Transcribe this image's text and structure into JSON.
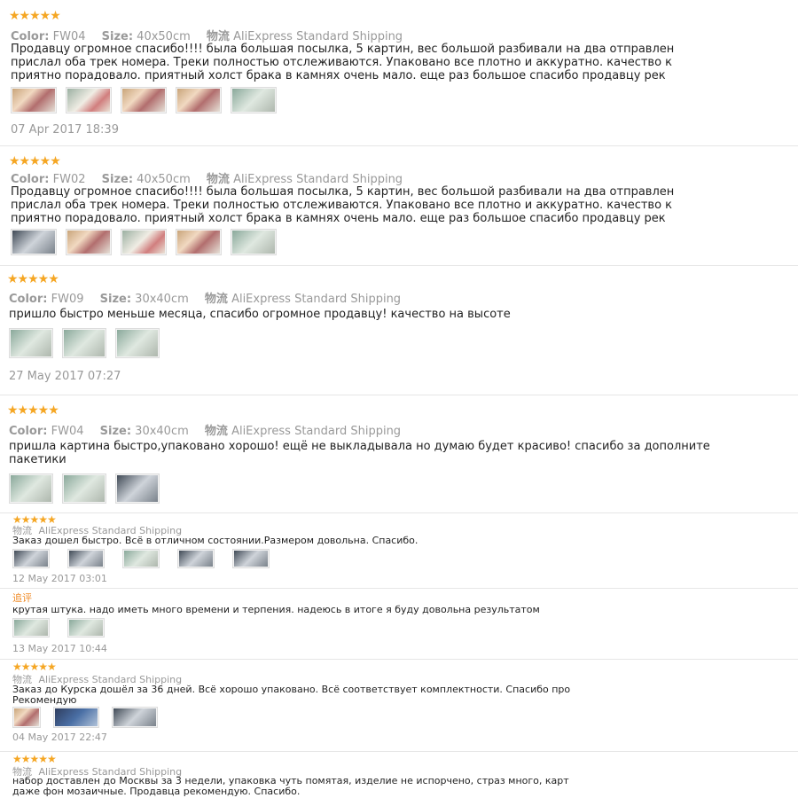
{
  "reviews": [
    {
      "color_label": "Color:",
      "color": "FW04",
      "size_label": "Size:",
      "size": "40x50cm",
      "ship_label": "物流",
      "shipping": "AliExpress Standard Shipping",
      "text": "Продавцу огромное спасибо!!!! была большая посылка, 5 картин, вес большой разбивали на два отправлен\nприслал оба трек номера. Треки полностью отслеживаются. Упаковано все плотно и аккуратно. качество к\nприятно порадовало. приятный холст брака в камнях очень мало. еще раз большое спасибо продавцу рек",
      "date": "07 Apr 2017 18:39"
    },
    {
      "color_label": "Color:",
      "color": "FW02",
      "size_label": "Size:",
      "size": "40x50cm",
      "ship_label": "物流",
      "shipping": "AliExpress Standard Shipping",
      "text": "Продавцу огромное спасибо!!!! была большая посылка, 5 картин, вес большой разбивали на два отправлен\nприслал оба трек номера. Треки полностью отслеживаются. Упаковано все плотно и аккуратно. качество к\nприятно порадовало. приятный холст брака в камнях очень мало. еще раз большое спасибо продавцу рек"
    },
    {
      "color_label": "Color:",
      "color": "FW09",
      "size_label": "Size:",
      "size": "30x40cm",
      "ship_label": "物流",
      "shipping": "AliExpress Standard Shipping",
      "text": "пришло быстро меньше месяца, спасибо огромное продавцу! качество на высоте",
      "date": "27 May 2017 07:27"
    },
    {
      "color_label": "Color:",
      "color": "FW04",
      "size_label": "Size:",
      "size": "30x40cm",
      "ship_label": "物流",
      "shipping": "AliExpress Standard Shipping",
      "text": "пришла картина быстро,упаковано хорошо! ещё не выкладывала но думаю будет красиво! спасибо за дополните\nпакетики"
    },
    {
      "ship_label": "物流",
      "shipping": "AliExpress Standard Shipping",
      "text": "Заказ дошел быстро. Всё в отличном состоянии.Размером довольна. Спасибо.",
      "date": "12 May 2017 03:01"
    },
    {
      "tag": "追评",
      "text": "крутая штука. надо иметь много времени и терпения. надеюсь в итоге я буду довольна результатом",
      "date": "13 May 2017 10:44"
    },
    {
      "ship_label": "物流",
      "shipping": "AliExpress Standard Shipping",
      "text": "Заказ до Курска дошёл за 36 дней. Всё хорошо упаковано. Всё соответствует комплектности. Спасибо про\nРекомендую",
      "date": "04 May 2017 22:47"
    },
    {
      "ship_label": "物流",
      "shipping": "AliExpress Standard Shipping",
      "text": "набор доставлен до Москвы за 3 недели, упаковка чуть помятая, изделие не испорчено, страз много, карт\nдаже фон мозаичные. Продавца рекомендую. Спасибо."
    }
  ],
  "stars_glyph": "★★★★★",
  "star_color": "#f5a623"
}
